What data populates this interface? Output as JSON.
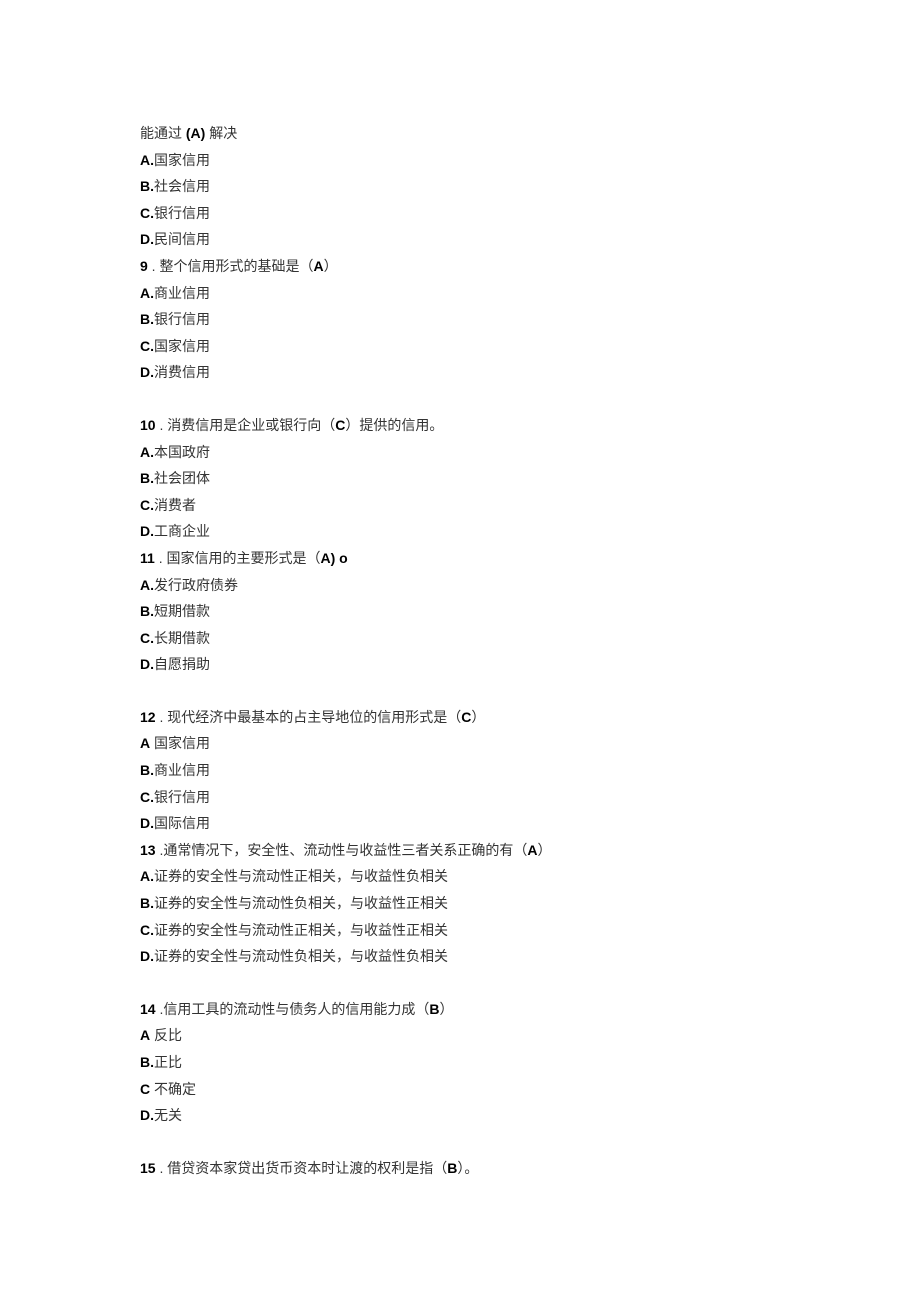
{
  "q8": {
    "stem_cont_pre": "能通过 ",
    "stem_cont_answer": "(A)",
    "stem_cont_post": " 解决",
    "optA_label": "A.",
    "optA_text": "国家信用",
    "optB_label": "B.",
    "optB_text": "社会信用",
    "optC_label": "C.",
    "optC_text": "银行信用",
    "optD_label": "D.",
    "optD_text": "民间信用"
  },
  "q9": {
    "num": "9",
    "stem": " . 整个信用形式的基础是（",
    "answer": "A",
    "stem_post": "）",
    "optA_label": "A.",
    "optA_text": "商业信用",
    "optB_label": "B.",
    "optB_text": "银行信用",
    "optC_label": "C.",
    "optC_text": "国家信用",
    "optD_label": "D.",
    "optD_text": "消费信用"
  },
  "q10": {
    "num": "10",
    "stem": " . 消费信用是企业或银行向（",
    "answer": "C",
    "stem_post": "）提供的信用。",
    "optA_label": "A.",
    "optA_text": "本国政府",
    "optB_label": "B.",
    "optB_text": "社会团体",
    "optC_label": "C.",
    "optC_text": "消费者",
    "optD_label": "D.",
    "optD_text": "工商企业"
  },
  "q11": {
    "num": "11",
    "stem": " . 国家信用的主要形式是（",
    "answer": "A",
    "stem_post": ") o",
    "optA_label": "A.",
    "optA_text": "发行政府债券",
    "optB_label": "B.",
    "optB_text": "短期借款",
    "optC_label": "C.",
    "optC_text": "长期借款",
    "optD_label": "D.",
    "optD_text": "自愿捐助"
  },
  "q12": {
    "num": "12",
    "stem": " . 现代经济中最基本的占主导地位的信用形式是（",
    "answer": "C",
    "stem_post": "）",
    "optA_label": "A",
    "optA_text": " 国家信用",
    "optB_label": "B.",
    "optB_text": "商业信用",
    "optC_label": "C.",
    "optC_text": "银行信用",
    "optD_label": "D.",
    "optD_text": "国际信用"
  },
  "q13": {
    "num": "13",
    "stem": " .通常情况下，安全性、流动性与收益性三者关系正确的有（",
    "answer": "A",
    "stem_post": "）",
    "optA_label": "A.",
    "optA_text": "证券的安全性与流动性正相关，与收益性负相关",
    "optB_label": "B.",
    "optB_text": "证券的安全性与流动性负相关，与收益性正相关",
    "optC_label": "C.",
    "optC_text": "证券的安全性与流动性正相关，与收益性正相关",
    "optD_label": "D.",
    "optD_text": "证券的安全性与流动性负相关，与收益性负相关"
  },
  "q14": {
    "num": "14",
    "stem": " .信用工具的流动性与债务人的信用能力成（",
    "answer": "B",
    "stem_post": "）",
    "optA_label": "A",
    "optA_text": " 反比",
    "optB_label": "B.",
    "optB_text": "正比",
    "optC_label": "C",
    "optC_text": " 不确定",
    "optD_label": "D.",
    "optD_text": "无关"
  },
  "q15": {
    "num": "15",
    "stem": " . 借贷资本家贷出货币资本时让渡的权利是指（",
    "answer": "B",
    "stem_post": "）。"
  }
}
